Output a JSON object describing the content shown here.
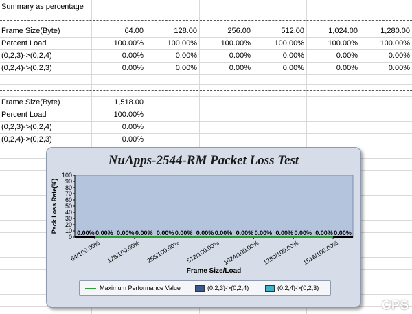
{
  "sheet": {
    "summary_title": "Summary as percentage",
    "table1": {
      "rows": [
        {
          "label": "Frame Size(Byte)",
          "values": [
            "64.00",
            "128.00",
            "256.00",
            "512.00",
            "1,024.00",
            "1,280.00"
          ]
        },
        {
          "label": "Percent Load",
          "values": [
            "100.00%",
            "100.00%",
            "100.00%",
            "100.00%",
            "100.00%",
            "100.00%"
          ]
        },
        {
          "label": "(0,2,3)->(0,2,4)",
          "values": [
            "0.00%",
            "0.00%",
            "0.00%",
            "0.00%",
            "0.00%",
            "0.00%"
          ]
        },
        {
          "label": "(0,2,4)->(0,2,3)",
          "values": [
            "0.00%",
            "0.00%",
            "0.00%",
            "0.00%",
            "0.00%",
            "0.00%"
          ]
        }
      ]
    },
    "table2": {
      "rows": [
        {
          "label": "Frame Size(Byte)",
          "values": [
            "1,518.00"
          ]
        },
        {
          "label": "Percent Load",
          "values": [
            "100.00%"
          ]
        },
        {
          "label": "(0,2,3)->(0,2,4)",
          "values": [
            "0.00%"
          ]
        },
        {
          "label": "(0,2,4)->(0,2,3)",
          "values": [
            "0.00%"
          ]
        }
      ]
    }
  },
  "chart_data": {
    "type": "bar",
    "title": "NuApps-2544-RM Packet Loss Test",
    "xlabel": "Frame Size/Load",
    "ylabel": "Pack Loss Rate(%)",
    "ylim": [
      0,
      100
    ],
    "yticks": [
      "0",
      "10",
      "20",
      "30",
      "40",
      "50",
      "60",
      "70",
      "80",
      "90",
      "100"
    ],
    "categories": [
      "64/100.00%",
      "128/100.00%",
      "256/100.00%",
      "512/100.00%",
      "1024/100.00%",
      "1280/100.00%",
      "1518/100.00%"
    ],
    "series": [
      {
        "name": "Maximum Performance Value",
        "kind": "line",
        "values": [
          0,
          0,
          0,
          0,
          0,
          0,
          0
        ],
        "color": "#2e9d3a"
      },
      {
        "name": "(0,2,3)->(0,2,4)",
        "kind": "bar",
        "values": [
          0,
          0,
          0,
          0,
          0,
          0,
          0
        ],
        "color": "#3b5a8f"
      },
      {
        "name": "(0,2,4)->(0,2,3)",
        "kind": "bar",
        "values": [
          0,
          0,
          0,
          0,
          0,
          0,
          0
        ],
        "color": "#3fb3c9"
      }
    ],
    "data_labels": [
      "0.00%",
      "0.00%"
    ],
    "plot_color": "#b4c4dd",
    "grid": false,
    "legend_position": "bottom"
  },
  "watermark": "CPS"
}
